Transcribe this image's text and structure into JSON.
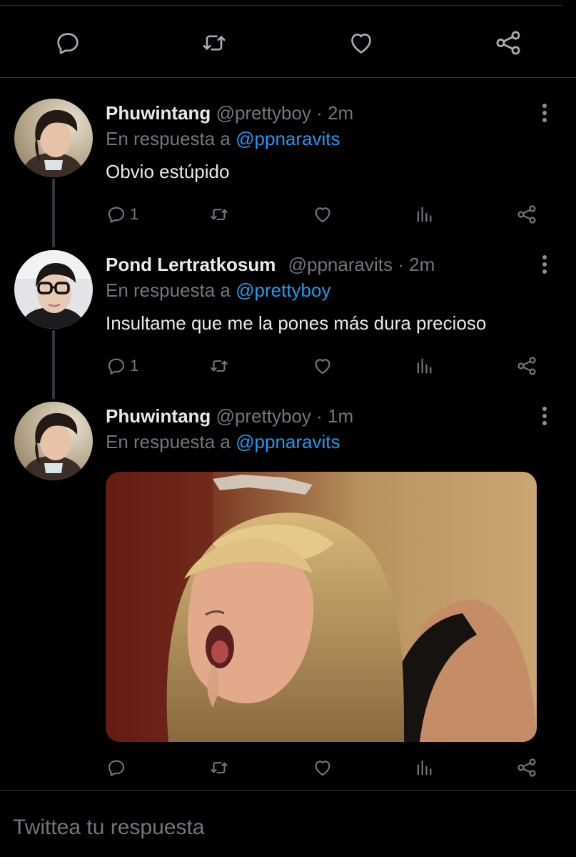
{
  "top_actions": {
    "reply_icon": "reply-icon",
    "retweet_icon": "retweet-icon",
    "like_icon": "heart-icon",
    "share_icon": "share-icon"
  },
  "tweets": [
    {
      "name": "Phuwintang",
      "handle": "@prettyboy",
      "separator": "·",
      "time": "2m",
      "reply_prefix": "En respuesta a",
      "reply_to": "@ppnaravits",
      "text": "Obvio estúpido",
      "reply_count": "1"
    },
    {
      "name": "Pond Lertratkosum",
      "handle": "@ppnaravits",
      "separator": "·",
      "time": "2m",
      "reply_prefix": "En respuesta a",
      "reply_to": "@prettyboy",
      "text": "Insultame que me la pones más dura precioso",
      "reply_count": "1"
    },
    {
      "name": "Phuwintang",
      "handle": "@prettyboy",
      "separator": "·",
      "time": "1m",
      "reply_prefix": "En respuesta a",
      "reply_to": "@ppnaravits",
      "reply_count": ""
    }
  ],
  "composer": {
    "placeholder": "Twittea tu respuesta"
  },
  "colors": {
    "background": "#000000",
    "text": "#e7e9ea",
    "secondary": "#71767b",
    "link": "#1d9bf0",
    "divider": "#2f3336"
  }
}
